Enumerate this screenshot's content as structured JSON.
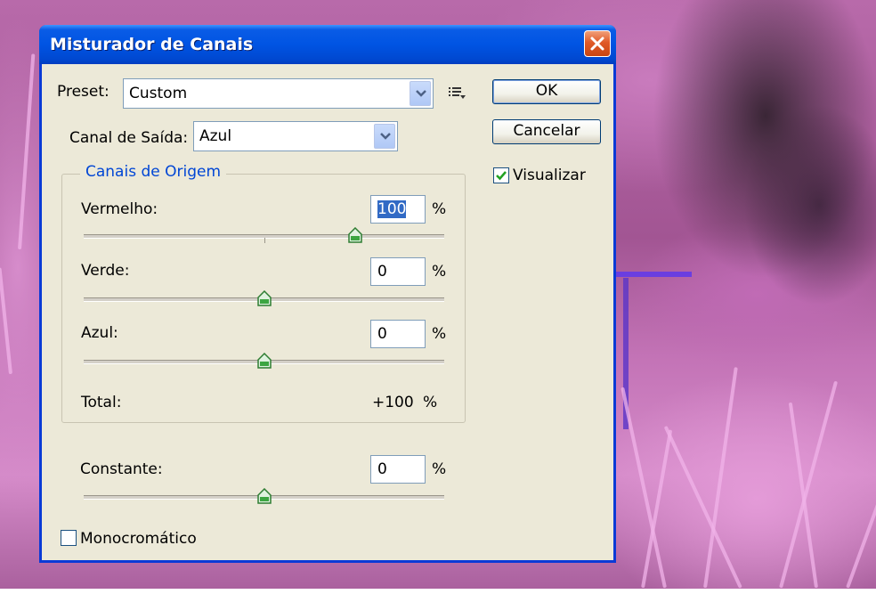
{
  "dialog": {
    "title": "Misturador de Canais",
    "preset_label": "Preset:",
    "preset_value": "Custom",
    "output_channel_label": "Canal de Saída:",
    "output_channel_value": "Azul",
    "ok_label": "OK",
    "cancel_label": "Cancelar",
    "preview_label": "Visualizar",
    "preview_checked": true,
    "group_title": "Canais de Origem",
    "channels": [
      {
        "label": "Vermelho:",
        "value": "100",
        "unit": "%",
        "slider_percent": 100
      },
      {
        "label": "Verde:",
        "value": "0",
        "unit": "%",
        "slider_percent": 0
      },
      {
        "label": "Azul:",
        "value": "0",
        "unit": "%",
        "slider_percent": 0
      }
    ],
    "total_label": "Total:",
    "total_value": "+100",
    "total_unit": "%",
    "constant_label": "Constante:",
    "constant_value": "0",
    "constant_unit": "%",
    "constant_slider_percent": 0,
    "monochrome_label": "Monocromático",
    "monochrome_checked": false
  },
  "colors": {
    "title_bar": "#0054e3",
    "dialog_bg": "#ece9d8",
    "group_title": "#0046d5",
    "selection": "#316ac5",
    "close_button": "#e05a28"
  },
  "icons": [
    "close-icon",
    "dropdown-arrow-icon",
    "preset-options-icon",
    "checkmark-icon",
    "slider-thumb-icon"
  ]
}
